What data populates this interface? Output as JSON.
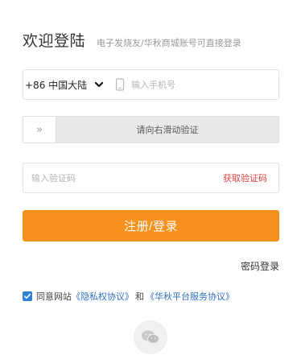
{
  "header": {
    "title": "欢迎登陆",
    "subtitle": "电子发烧友/华秋商城账号可直接登录"
  },
  "phone": {
    "country_code": "+86 中国大陆",
    "placeholder": "输入手机号"
  },
  "slider": {
    "handle_glyph": "»",
    "text": "请向右滑动验证"
  },
  "code": {
    "placeholder": "输入验证码",
    "get_code_label": "获取验证码"
  },
  "submit": {
    "label": "注册/登录"
  },
  "password_login": {
    "label": "密码登录"
  },
  "agreement": {
    "checked": true,
    "prefix": "同意网站",
    "privacy": "《隐私权协议》",
    "and": "和",
    "service": "《华秋平台服务协议》"
  },
  "icons": {
    "chevron": "chevron-down-icon",
    "phone": "mobile-phone-icon",
    "wechat": "wechat-icon",
    "check": "checkmark-icon"
  },
  "colors": {
    "accent": "#f7911d",
    "get_code": "#e94343",
    "link": "#2f6fc2",
    "checkbox": "#2f80d8"
  }
}
